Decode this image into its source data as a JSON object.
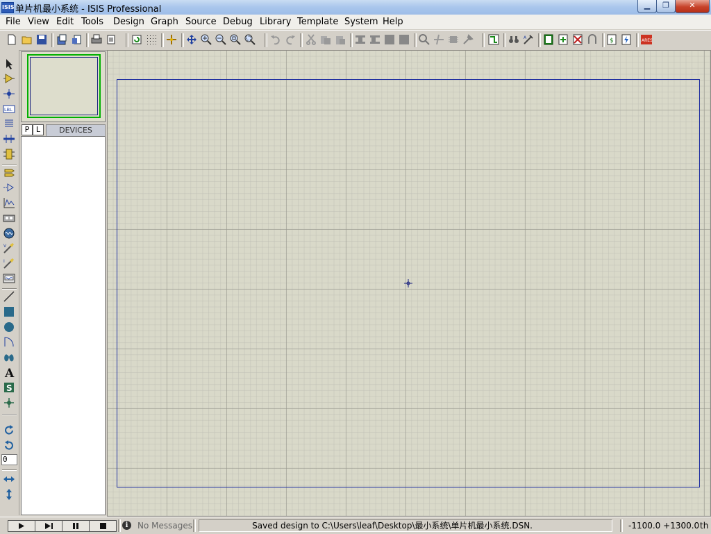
{
  "window": {
    "title": "单片机最小系统 - ISIS Professional",
    "app_icon": "ISIS",
    "minimize": "▁",
    "maximize": "❐",
    "close": "✕"
  },
  "menu": [
    "File",
    "View",
    "Edit",
    "Tools",
    "Design",
    "Graph",
    "Source",
    "Debug",
    "Library",
    "Template",
    "System",
    "Help"
  ],
  "device_panel": {
    "p_button": "P",
    "l_button": "L",
    "label": "DEVICES"
  },
  "rotation_value": "0",
  "toolbar_icons": [
    "new-icon",
    "open-icon",
    "save-icon",
    "import-icon",
    "export-icon",
    "print-icon",
    "print-area-icon",
    "refresh-icon",
    "grid-icon",
    "origin-icon",
    "pan-icon",
    "zoom-in-icon",
    "zoom-out-icon",
    "zoom-all-icon",
    "zoom-area-icon",
    "undo-icon",
    "redo-icon",
    "cut-icon",
    "copy-icon",
    "paste-icon",
    "block-copy-icon",
    "block-move-icon",
    "block-rotate-icon",
    "block-delete-icon",
    "pick-device-icon",
    "make-device-icon",
    "packaging-tool-icon",
    "decompose-icon",
    "wire-autorouter-icon",
    "search-tag-icon",
    "property-assign-icon",
    "new-sheet-icon",
    "add-sheet-icon",
    "remove-sheet-icon",
    "exit-to-parent-icon",
    "bom-icon",
    "electrical-check-icon",
    "ares-icon"
  ],
  "left_tool_icons": [
    "selection-icon",
    "component-icon",
    "junction-icon",
    "wire-label-icon",
    "text-script-icon",
    "bus-icon",
    "subcircuit-icon",
    "terminal-icon",
    "device-pin-icon",
    "graph-icon",
    "tape-recorder-icon",
    "generator-icon",
    "voltage-probe-icon",
    "current-probe-icon",
    "virtual-instrument-icon",
    "line-2d-icon",
    "box-2d-icon",
    "circle-2d-icon",
    "arc-2d-icon",
    "path-2d-icon",
    "text-2d-icon",
    "symbol-2d-icon",
    "marker-2d-icon",
    "rotate-cw-icon",
    "rotate-ccw-icon",
    "mirror-x-icon",
    "mirror-y-icon"
  ],
  "simulation": {
    "play": "play-icon",
    "step": "step-icon",
    "pause": "pause-icon",
    "stop": "stop-icon"
  },
  "status": {
    "messages": "No Messages",
    "message_icon": "i",
    "text": "Saved design to C:\\Users\\leaf\\Desktop\\最小系统\\单片机最小系统.DSN.",
    "coordinates": "-1100.0  +1300.0",
    "units": "th"
  },
  "colors": {
    "sheet_border": "#2030a0",
    "grid_bg": "#d9d9c9",
    "overview_frame": "#00b000",
    "ares_red": "#cc3322"
  }
}
